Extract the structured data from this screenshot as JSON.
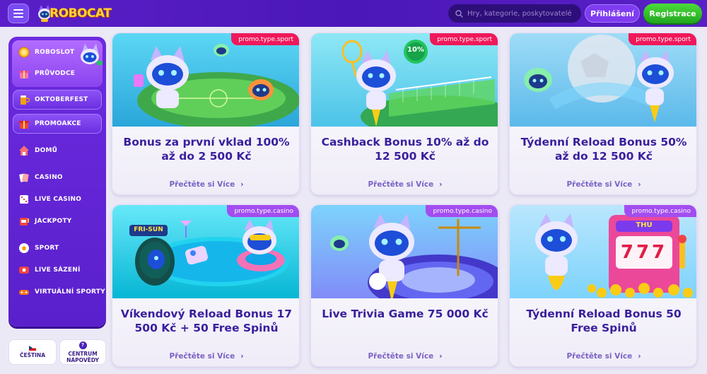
{
  "header": {
    "logo_text": "ROBOCAT",
    "search_placeholder": "Hry, kategorie, poskytovatelé",
    "login_label": "Přihlášení",
    "register_label": "Registrace"
  },
  "sidebar": {
    "top_items": [
      {
        "label": "ROBOSLOT",
        "icon": "coin-icon"
      },
      {
        "label": "PRŮVODCE",
        "icon": "gift-icon"
      }
    ],
    "pills": [
      {
        "label": "OKTOBERFEST",
        "icon": "beer-icon"
      },
      {
        "label": "PROMOAKCE",
        "icon": "gift-icon"
      }
    ],
    "items": [
      {
        "label": "DOMŮ",
        "icon": "home-icon"
      },
      {
        "label": "CASINO",
        "icon": "cards-icon"
      },
      {
        "label": "LIVE CASINO",
        "icon": "dice-icon"
      },
      {
        "label": "JACKPOTY",
        "icon": "slot-icon"
      },
      {
        "label": "SPORT",
        "icon": "ball-icon"
      },
      {
        "label": "LIVE SÁZENÍ",
        "icon": "live-icon"
      },
      {
        "label": "VIRTUÁLNÍ SPORTY",
        "icon": "controller-icon"
      }
    ],
    "language_label": "ČEŠTINA",
    "help_label_1": "CENTRUM",
    "help_label_2": "NÁPOVĚDY"
  },
  "cards": [
    {
      "tag": "promo.type.sport",
      "title": "Bonus za první vklad 100% až do 2 500 Kč",
      "link": "Přečtěte si Více"
    },
    {
      "tag": "promo.type.sport",
      "title": "Cashback Bonus 10% až do 12 500 Kč",
      "link": "Přečtěte si Více",
      "badge": "10%"
    },
    {
      "tag": "promo.type.sport",
      "title": "Týdenní Reload Bonus 50% až do 12 500 Kč",
      "link": "Přečtěte si Více"
    },
    {
      "tag": "promo.type.casino",
      "title": "Víkendový Reload Bonus 17 500 Kč + 50 Free Spinů",
      "link": "Přečtěte si Více",
      "sign": "FRI-SUN"
    },
    {
      "tag": "promo.type.casino",
      "title": "Live Trivia Game 75 000 Kč",
      "link": "Přečtěte si Více"
    },
    {
      "tag": "promo.type.casino",
      "title": "Týdenní Reload Bonus 50 Free Spinů",
      "link": "Přečtěte si Více",
      "sign": "THU",
      "reels": "777"
    }
  ],
  "colors": {
    "header": "#4b17b8",
    "sidebar": "#6c2ae0",
    "title": "#3a1f9c",
    "sport_tag": "#f0185a",
    "casino_tag": "#a24df0",
    "register": "#2fbf28"
  }
}
